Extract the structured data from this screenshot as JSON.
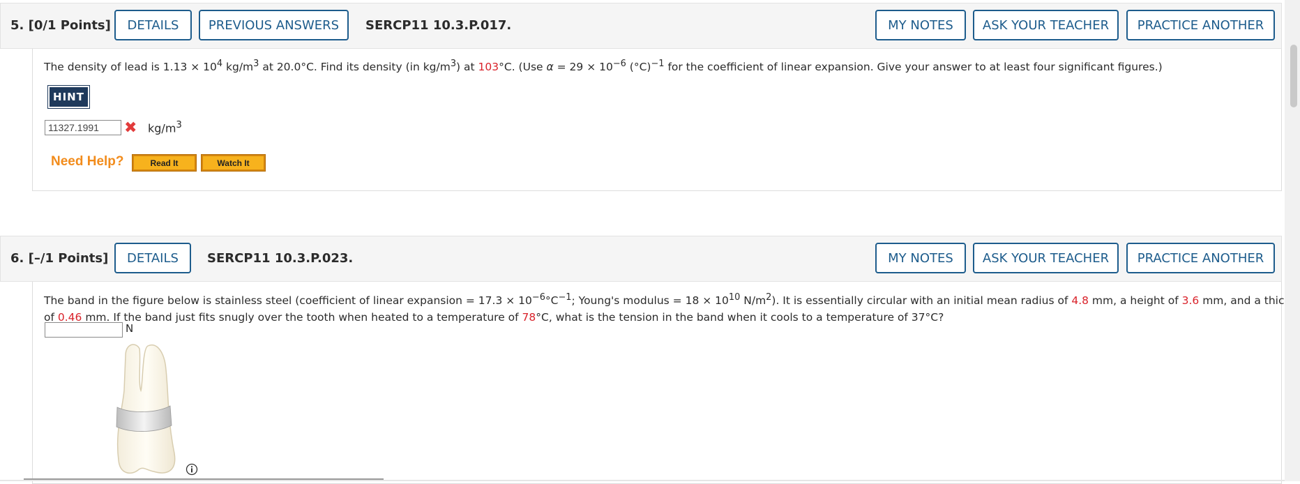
{
  "q5": {
    "number": "5.",
    "points": "[0/1 Points]",
    "details_label": "DETAILS",
    "prev_answers_label": "PREVIOUS ANSWERS",
    "code": "SERCP11 10.3.P.017.",
    "my_notes_label": "MY NOTES",
    "ask_teacher_label": "ASK YOUR TEACHER",
    "practice_label": "PRACTICE ANOTHER",
    "text_1": "The density of lead is 1.13 × 10",
    "text_exp1": "4",
    "text_2": " kg/m",
    "text_exp2": "3",
    "text_3": " at 20.0°C. Find its density (in kg/m",
    "text_exp3": "3",
    "text_4": ") at ",
    "temp_value": "103",
    "text_5": "°C. (Use ",
    "alpha": "α",
    "text_6": " = 29 × 10",
    "text_exp4": "−6",
    "text_7": " (°C)",
    "text_exp5": "−1",
    "text_8": " for the coefficient of linear expansion. Give your answer to at least four significant figures.)",
    "hint_label": "HINT",
    "answer_value": "11327.1991",
    "answer_unit": "kg/m",
    "answer_unit_exp": "3",
    "incorrect_icon": "x-mark-icon",
    "need_help_label": "Need Help?",
    "read_it_label": "Read It",
    "watch_it_label": "Watch It"
  },
  "q6": {
    "number": "6.",
    "points": "[–/1 Points]",
    "details_label": "DETAILS",
    "code": "SERCP11 10.3.P.023.",
    "my_notes_label": "MY NOTES",
    "ask_teacher_label": "ASK YOUR TEACHER",
    "practice_label": "PRACTICE ANOTHER",
    "l1_a": "The band in the figure below is stainless steel (coefficient of linear expansion = 17.3 × 10",
    "l1_exp1": "−6",
    "l1_b": "°C",
    "l1_exp2": "−1",
    "l1_c": "; Young's modulus = 18 × 10",
    "l1_exp3": "10",
    "l1_d": " N/m",
    "l1_exp4": "2",
    "l1_e": "). It is essentially circular with an initial mean radius of ",
    "radius": "4.8",
    "l1_f": " mm, a height of ",
    "height": "3.6",
    "l1_g": " mm, and a thickness",
    "l2_a": "of ",
    "thickness": "0.46",
    "l2_b": " mm. If the band just fits snugly over the tooth when heated to a temperature of ",
    "heat_temp": "78",
    "l2_c": "°C, what is the tension in the band when it cools to a temperature of 37°C?",
    "answer_value": "",
    "answer_unit": "N",
    "info_icon": "info-icon",
    "figure": "tooth-with-band-figure"
  },
  "colors": {
    "accent": "#1d5c8c",
    "red_value": "#d9222a",
    "need_help": "#f28c1c"
  }
}
